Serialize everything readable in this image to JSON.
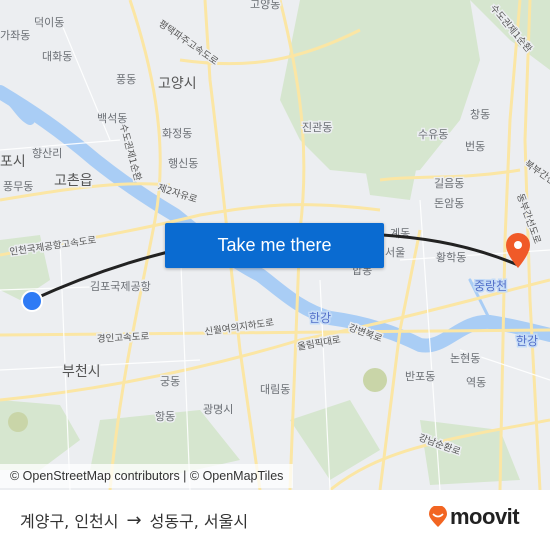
{
  "map": {
    "labels": [
      "덕이동",
      "가좌동",
      "대화동",
      "풍동",
      "고양시",
      "고양동",
      "백석동",
      "화정동",
      "행신동",
      "향산리",
      "포시",
      "고촌읍",
      "풍무동",
      "진관동",
      "수유동",
      "창동",
      "번동",
      "길음동",
      "돈암동",
      "계동",
      "황학동",
      "김포국제공항",
      "부천시",
      "궁동",
      "광명시",
      "항동",
      "대림동",
      "반포동",
      "논현동",
      "역동",
      "합동",
      "서울"
    ],
    "road_labels": [
      "평택파주고속도로",
      "수도권제1순환",
      "제2자유로",
      "인천국제공항고속도로",
      "경인고속도로",
      "신월여의지하도로",
      "올림픽대로",
      "강변북로",
      "강남순환로",
      "북부간선",
      "동부간선도로",
      "수도권제1순환"
    ],
    "water_labels": [
      "한강",
      "한강",
      "중랑천"
    ],
    "colors": {
      "route": "#222222",
      "origin": "#2f7bf5",
      "destination": "#f05a28",
      "button": "#0a6bd1"
    }
  },
  "cta": {
    "label": "Take me there"
  },
  "attribution": "© OpenStreetMap contributors | © OpenMapTiles",
  "route": {
    "origin": "계양구, 인천시",
    "arrow": "→",
    "destination": "성동구, 서울시"
  },
  "brand": {
    "name": "moovit",
    "color": "#f26522"
  }
}
